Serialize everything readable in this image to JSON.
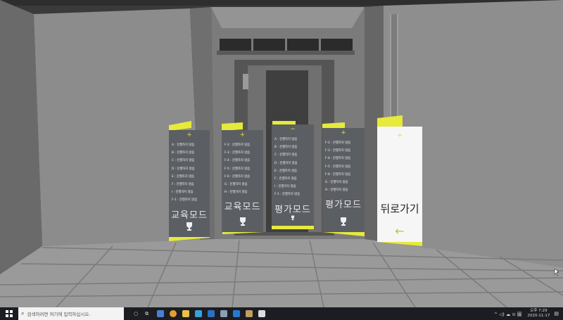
{
  "panels": [
    {
      "plus": "+",
      "items": [
        "A : 진행하지 않음",
        "B : 진행하지 않음",
        "C : 진행하지 않음",
        "D : 진행하지 않음",
        "E : 진행하지 않음",
        "F : 진행하지 않음",
        "I : 진행하지 않음",
        "F-1 : 진행하지 않음"
      ],
      "mode": "교육모드"
    },
    {
      "plus": "+",
      "items": [
        "F-2 : 진행하지 않음",
        "F-3 : 진행하지 않음",
        "F-4 : 진행하지 않음",
        "F-5 : 진행하지 않음",
        "F-6 : 진행하지 않음",
        "G : 진행하지 않음",
        "H : 진행하지 않음"
      ],
      "mode": "교육모드"
    },
    {
      "plus": "−",
      "items": [
        "A : 진행하지 않음",
        "B : 진행하지 않음",
        "C : 진행하지 않음",
        "D : 진행하지 않음",
        "E : 진행하지 않음",
        "F : 진행하지 않음",
        "I : 진행하지 않음",
        "F-1 : 진행하지 않음"
      ],
      "mode": "평가모드"
    },
    {
      "plus": "+",
      "items": [
        "F-2 : 진행하지 않음",
        "F-3 : 진행하지 않음",
        "F-4 : 진행하지 않음",
        "F-5 : 진행하지 않음",
        "F-6 : 진행하지 않음",
        "G : 진행하지 않음",
        "H : 진행하지 않음"
      ],
      "mode": "평가모드"
    }
  ],
  "back_panel": {
    "plus": "+",
    "label": "뒤로가기",
    "arrow": "←"
  },
  "taskbar": {
    "search_placeholder": "검색하려면 여기에 입력하십시오.",
    "tray_icons": "^ ◁) ☁ ⊙ 圖",
    "clock_period": "오후 7:29",
    "clock_date": "2020-11-17",
    "accent": "#e6ea3a"
  }
}
